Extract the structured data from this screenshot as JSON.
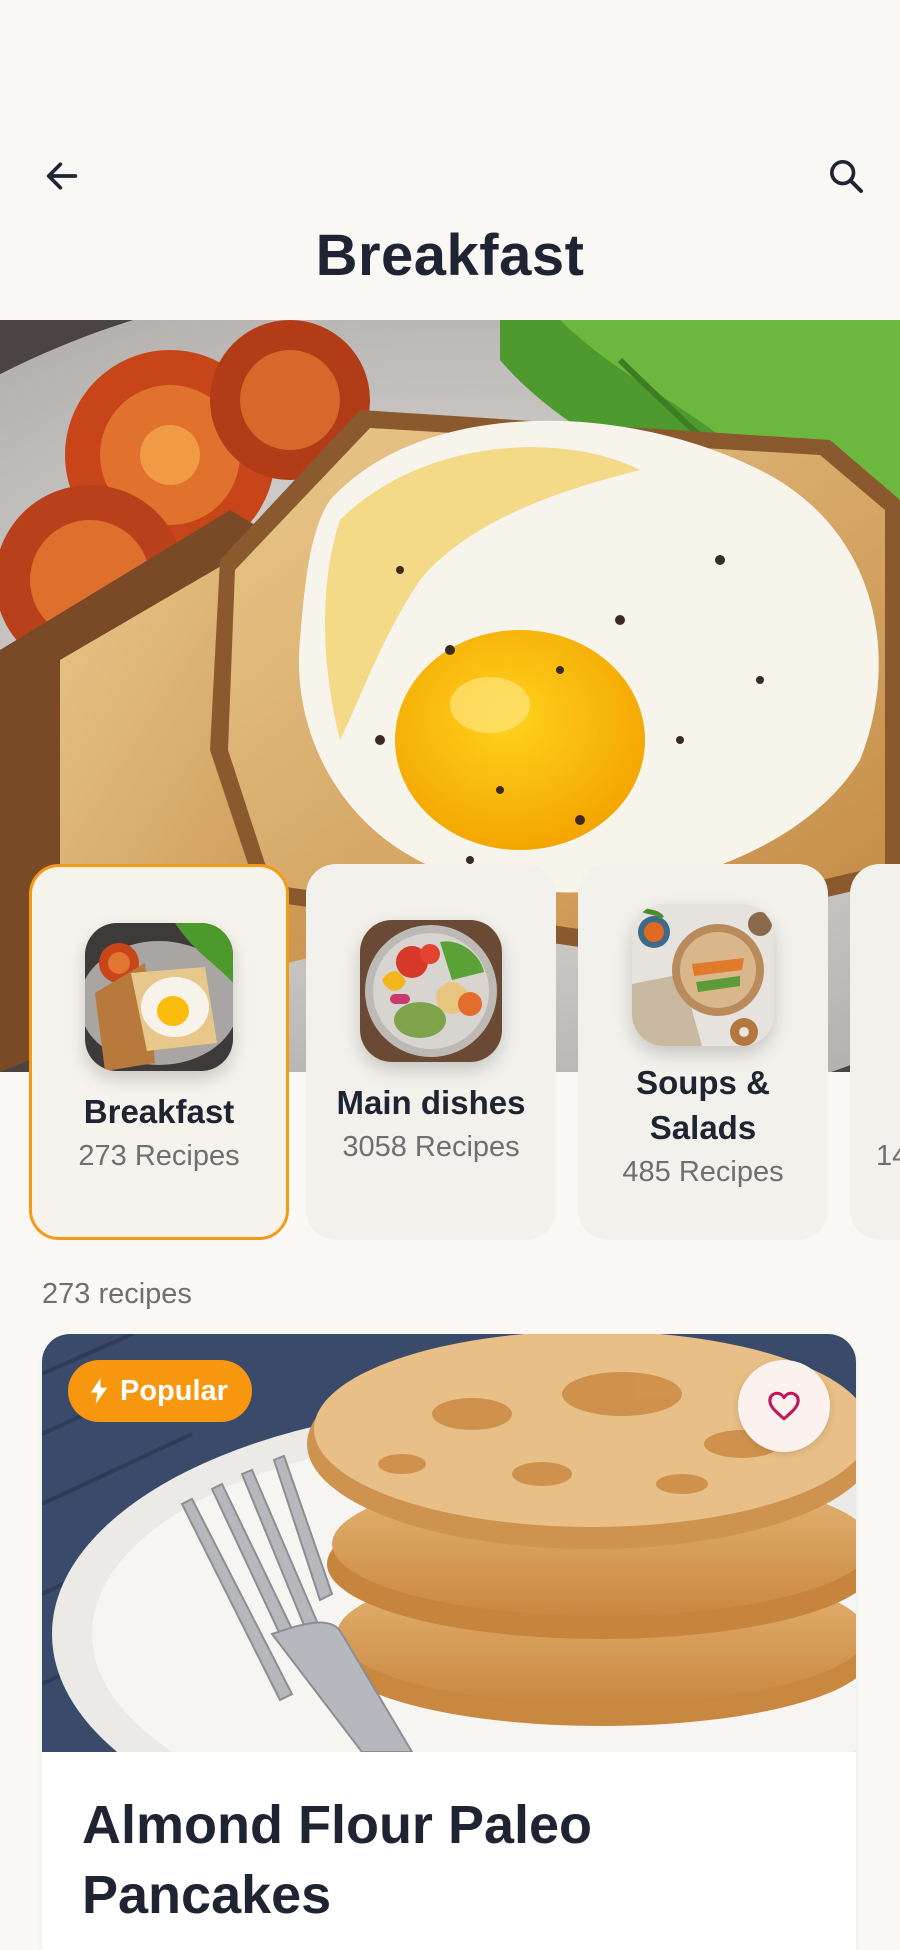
{
  "header": {
    "title": "Breakfast",
    "back_icon": "arrow-left-icon",
    "search_icon": "search-icon"
  },
  "categories": [
    {
      "name": "Breakfast",
      "count": "273 Recipes",
      "active": true
    },
    {
      "name": "Main dishes",
      "count": "3058 Recipes",
      "active": false
    },
    {
      "name": "Soups & Salads",
      "name_line1": "Soups &",
      "name_line2": "Salads",
      "count": "485 Recipes",
      "active": false
    },
    {
      "name": "",
      "count": "14",
      "active": false
    }
  ],
  "results": {
    "count_label": "273 recipes"
  },
  "recipe": {
    "badge_label": "Popular",
    "badge_icon": "lightning-icon",
    "favorite_icon": "heart-icon",
    "title": "Almond Flour Paleo Pancakes"
  },
  "colors": {
    "accent": "#f7960f",
    "text_primary": "#1f2433",
    "text_secondary": "#6f6f72",
    "background": "#f9f8f4",
    "card": "#f3f1eb",
    "favorite": "#c2185b"
  }
}
